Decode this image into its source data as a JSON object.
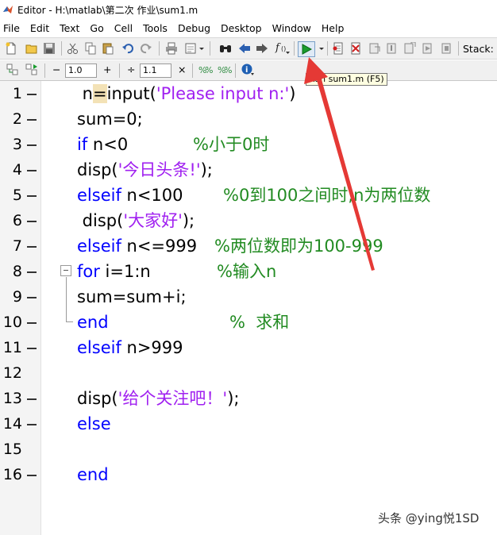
{
  "window": {
    "title": "Editor - H:\\matlab\\第二次 作业\\sum1.m"
  },
  "menu": {
    "items": [
      "File",
      "Edit",
      "Text",
      "Go",
      "Cell",
      "Tools",
      "Debug",
      "Desktop",
      "Window",
      "Help"
    ]
  },
  "toolbar": {
    "stack_label": "Stack:",
    "cell_minus": "−",
    "cell_value": "1.0",
    "cell_plus": "+",
    "cell_divide": "÷",
    "cell_value2": "1.1",
    "cell_times": "×",
    "run_tooltip": "Run sum1.m (F5)"
  },
  "editor": {
    "lines": [
      {
        "num": "1"
      },
      {
        "num": "2"
      },
      {
        "num": "3"
      },
      {
        "num": "4"
      },
      {
        "num": "5"
      },
      {
        "num": "6"
      },
      {
        "num": "7"
      },
      {
        "num": "8"
      },
      {
        "num": "9"
      },
      {
        "num": "10"
      },
      {
        "num": "11"
      },
      {
        "num": "12"
      },
      {
        "num": "13"
      },
      {
        "num": "14"
      },
      {
        "num": "15"
      },
      {
        "num": "16"
      }
    ],
    "code": {
      "l1_pre": " n",
      "l1_eq": "=",
      "l1_fn": "input(",
      "l1_str": "'Please input n:'",
      "l1_close": ")",
      "l2": "sum=0;",
      "l3_kw": "if",
      "l3_code": " n<0",
      "l3_cmt": "%小于0时",
      "l4_fn": "disp(",
      "l4_str": "'今日头条!'",
      "l4_close": ");",
      "l5_kw": "elseif",
      "l5_code": " n<100",
      "l5_cmt": "%0到100之间时,n为两位数",
      "l6_fn": " disp(",
      "l6_str": "'大家好'",
      "l6_close": ");",
      "l7_kw": "elseif",
      "l7_code": " n<=999",
      "l7_cmt": "%两位数即为100-999",
      "l8_kw": "for",
      "l8_code": " i=1:n",
      "l8_cmt": "%输入n",
      "l9": "sum=sum+i;",
      "l10_kw": "end",
      "l10_cmt": "%  求和",
      "l11_kw": "elseif",
      "l11_code": " n>999",
      "l13_fn": "disp(",
      "l13_str": "'给个关注吧！'",
      "l13_close": ");",
      "l14_kw": "else",
      "l16_kw": "end"
    }
  },
  "watermark": "头条 @ying悦1SD",
  "colors": {
    "keyword": "#0000ff",
    "string": "#a020f0",
    "comment": "#228b22",
    "annotation_arrow": "#e53935"
  },
  "icons": [
    "matlab-logo-icon",
    "new-file-icon",
    "open-folder-icon",
    "save-icon",
    "cut-icon",
    "copy-icon",
    "paste-icon",
    "undo-icon",
    "redo-icon",
    "print-icon",
    "find-icon",
    "back-arrow-icon",
    "forward-arrow-icon",
    "function-icon",
    "run-icon",
    "breakpoint-icon",
    "cell-icon",
    "help-icon"
  ]
}
